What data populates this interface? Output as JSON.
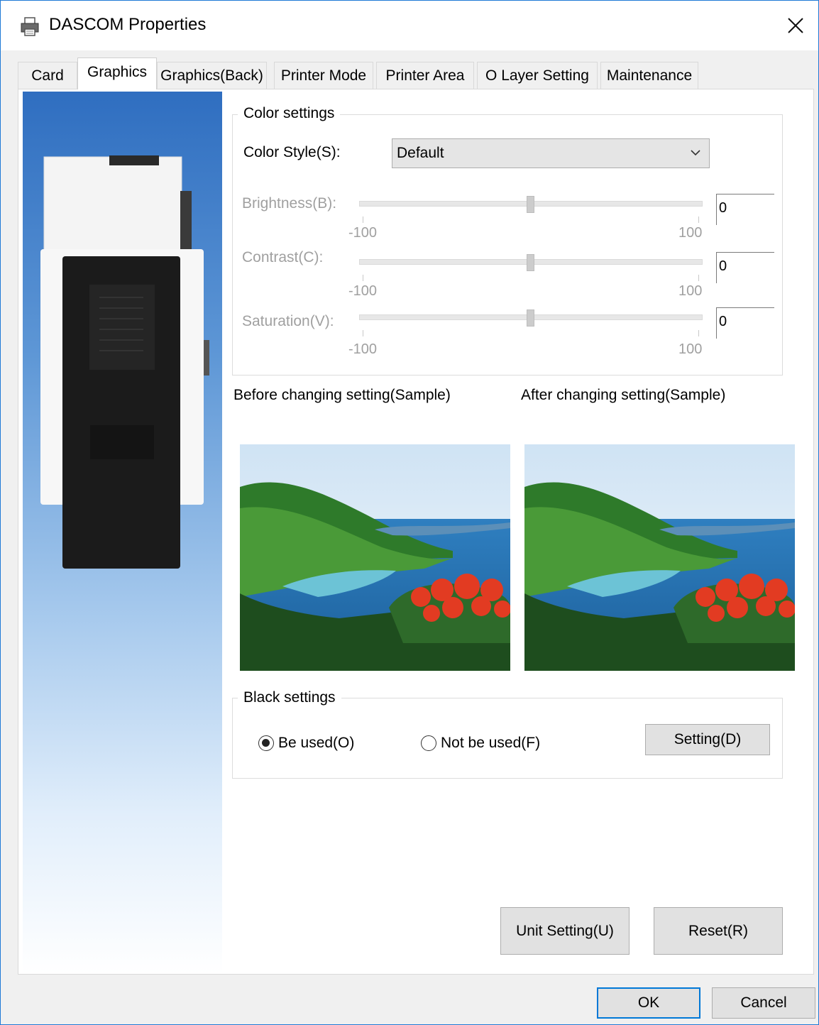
{
  "window": {
    "title": "DASCOM Properties"
  },
  "tabs": [
    {
      "label": "Card"
    },
    {
      "label": "Graphics"
    },
    {
      "label": "Graphics(Back)"
    },
    {
      "label": "Printer Mode"
    },
    {
      "label": "Printer Area"
    },
    {
      "label": "O Layer Setting"
    },
    {
      "label": "Maintenance"
    }
  ],
  "active_tab": "Graphics",
  "color_settings": {
    "title": "Color settings",
    "style_label": "Color Style(S):",
    "style_value": "Default",
    "brightness": {
      "label": "Brightness(B):",
      "value": "0",
      "min": "-100",
      "max": "100"
    },
    "contrast": {
      "label": "Contrast(C):",
      "value": "0",
      "min": "-100",
      "max": "100"
    },
    "saturation": {
      "label": "Saturation(V):",
      "value": "0",
      "min": "-100",
      "max": "100"
    }
  },
  "samples": {
    "before": "Before changing setting(Sample)",
    "after": "After changing setting(Sample)"
  },
  "black_settings": {
    "title": "Black settings",
    "be_used": "Be used(O)",
    "not_be_used": "Not be used(F)",
    "selected": "be_used",
    "setting_button": "Setting(D)"
  },
  "buttons": {
    "unit_setting": "Unit Setting(U)",
    "reset": "Reset(R)",
    "ok": "OK",
    "cancel": "Cancel"
  },
  "colors": {
    "accent": "#0078d7",
    "window_border": "#1f7ad6"
  }
}
